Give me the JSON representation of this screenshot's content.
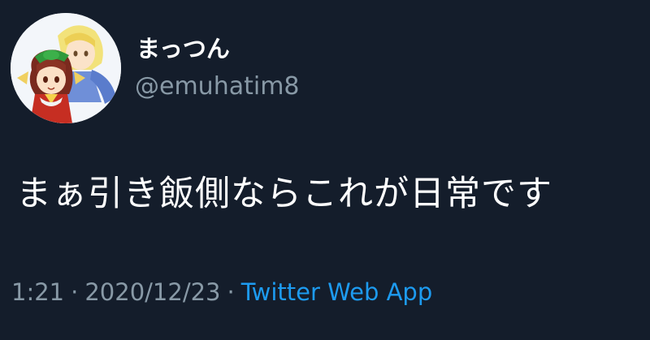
{
  "user": {
    "display_name": "まっつん",
    "handle": "@emuhatim8",
    "avatar_icon": "anime-character-avatar-icon"
  },
  "tweet": {
    "text": "まぁ引き飯側ならこれが日常です"
  },
  "meta": {
    "time": "1:21",
    "separator": "·",
    "date": "2020/12/23",
    "source": "Twitter Web App"
  },
  "colors": {
    "background": "#141d2b",
    "text": "#ffffff",
    "secondary": "#8899a6",
    "link": "#1d9bf0"
  }
}
